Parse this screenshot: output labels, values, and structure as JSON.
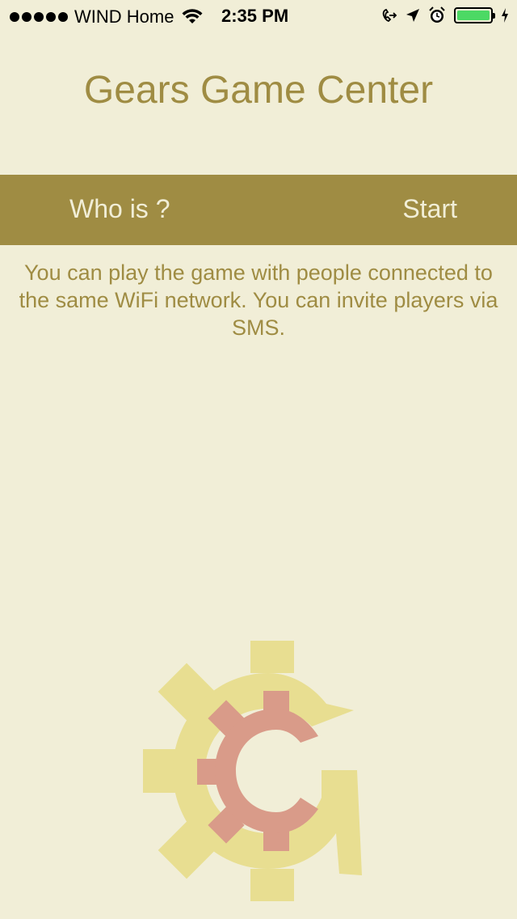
{
  "status_bar": {
    "carrier": "WIND Home",
    "time": "2:35 PM",
    "battery_level": 1.0,
    "icons": [
      "signal-icon",
      "wifi-icon",
      "call-forwarding-icon",
      "location-icon",
      "alarm-icon",
      "battery-icon",
      "charging-icon"
    ]
  },
  "header": {
    "title": "Gears Game Center"
  },
  "action_bar": {
    "who_label": "Who is ?",
    "start_label": "Start"
  },
  "main": {
    "info_text": "You can play the game with people connected to the same WiFi network. You can invite players via SMS."
  },
  "colors": {
    "background": "#f1eed7",
    "accent": "#9f8c43",
    "logo_outer": "#e8de91",
    "logo_inner": "#d99b89"
  }
}
